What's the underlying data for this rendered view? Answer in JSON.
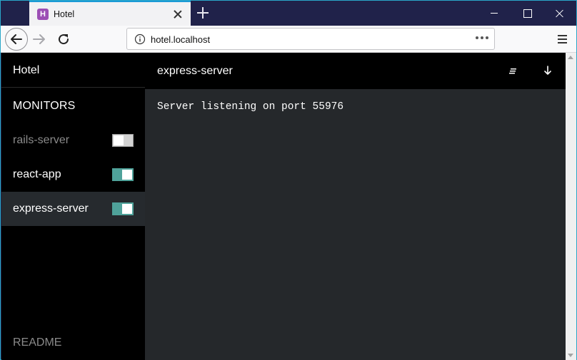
{
  "browser": {
    "tab_title": "Hotel",
    "tab_favicon_letter": "H",
    "url": "hotel.localhost"
  },
  "sidebar": {
    "brand": "Hotel",
    "section_title": "MONITORS",
    "monitors": [
      {
        "label": "rails-server",
        "running": false
      },
      {
        "label": "react-app",
        "running": true
      },
      {
        "label": "express-server",
        "running": true,
        "selected": true
      }
    ],
    "readme_label": "README"
  },
  "main": {
    "title": "express-server",
    "output_lines": [
      "Server listening on port 55976"
    ]
  },
  "colors": {
    "toggle_on": "#4fa29a",
    "selected_row": "#262a2e",
    "output_bg": "#25282b",
    "tab_accent": "#1b9ad6",
    "favicon": "#9c4fb5"
  },
  "icons": {
    "header_actions": [
      "clear-output-icon",
      "scroll-down-icon"
    ]
  }
}
